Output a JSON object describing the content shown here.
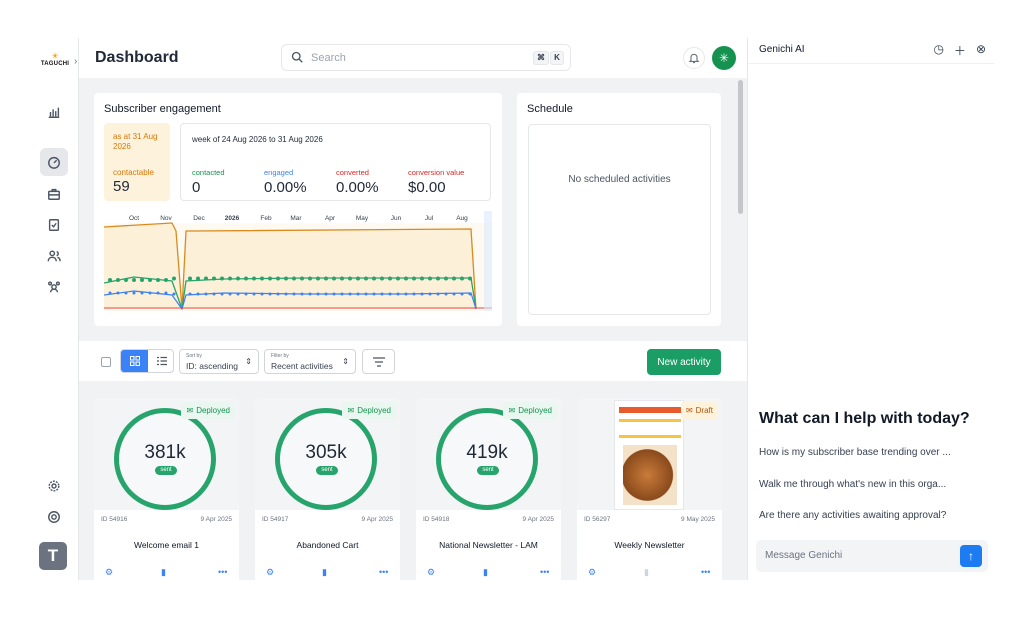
{
  "brand": {
    "logo_text": "TAGUCHI"
  },
  "header": {
    "title": "Dashboard",
    "search_placeholder": "Search",
    "kbd1": "⌘",
    "kbd2": "K"
  },
  "engagement": {
    "title": "Subscriber engagement",
    "as_at": "as at 31 Aug 2026",
    "contactable_label": "contactable",
    "contactable_value": "59",
    "week": "week of 24 Aug 2026 to 31 Aug 2026",
    "metrics": [
      {
        "label": "contacted",
        "value": "0",
        "color": "#15924f"
      },
      {
        "label": "engaged",
        "value": "0.00%",
        "color": "#3b82f6"
      },
      {
        "label": "converted",
        "value": "0.00%",
        "color": "#dc2626"
      },
      {
        "label": "conversion value",
        "value": "$0.00",
        "color": "#dc2626"
      }
    ],
    "months": [
      "Oct",
      "Nov",
      "Dec",
      "2026",
      "Feb",
      "Mar",
      "Apr",
      "May",
      "Jun",
      "Jul",
      "Aug"
    ]
  },
  "schedule": {
    "title": "Schedule",
    "empty": "No scheduled activities"
  },
  "toolbar": {
    "sort_label": "Sort by",
    "sort_value": "ID: ascending",
    "filter_label": "Filter by",
    "filter_value": "Recent activities",
    "new_activity": "New activity"
  },
  "activities": [
    {
      "id": "ID 54916",
      "date": "9 Apr 2025",
      "name": "Welcome email 1",
      "sent": "381k",
      "status": "Deployed"
    },
    {
      "id": "ID 54917",
      "date": "9 Apr 2025",
      "name": "Abandoned Cart",
      "sent": "305k",
      "status": "Deployed"
    },
    {
      "id": "ID 54918",
      "date": "9 Apr 2025",
      "name": "National Newsletter - LAM",
      "sent": "419k",
      "status": "Deployed"
    },
    {
      "id": "ID 56297",
      "date": "9 May 2025",
      "name": "Weekly Newsletter",
      "sent": "",
      "status": "Draft"
    }
  ],
  "sent_label": "sent",
  "panel": {
    "title": "Genichi AI",
    "help_title": "What can I help with today?",
    "suggestions": [
      "How is my subscriber base trending over ...",
      "Walk me through what's new in this orga...",
      "Are there any activities awaiting approval?"
    ],
    "message_placeholder": "Message Genichi"
  },
  "user_avatar_letter": "T"
}
